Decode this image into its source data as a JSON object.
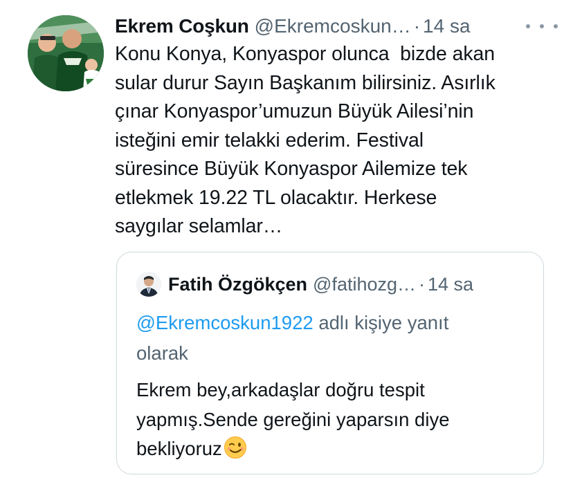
{
  "tweet": {
    "author_name": "Ekrem Coşkun",
    "author_handle": "@Ekremcoskun…",
    "separator": "·",
    "time": "14 sa",
    "text": "Konu Konya, Konyaspor olunca  bizde akan sular durur Sayın Başkanım bilirsiniz. Asırlık çınar Konyaspor’umuzun Büyük Ailesi’nin isteğini emir telakki ederim. Festival süresince Büyük Konyaspor Ailemize tek etlekmek 19.22 TL olacaktır. Herkese saygılar selamlar…",
    "text_lines": [
      "Konu Konya, Konyaspor olunca  bizde akan",
      "sular durur Sayın Başkanım bilirsiniz. Asırlık",
      "çınar Konyaspor’umuzun Büyük Ailesi’nin",
      "isteğini emir telakki ederim. Festival",
      "süresince Büyük Konyaspor Ailemize tek",
      "etlekmek 19.22 TL olacaktır. Herkese",
      "saygılar selamlar…"
    ],
    "more_icon": "more-horizontal-icon"
  },
  "quote": {
    "author_name": "Fatih Özgökçen",
    "author_handle": "@fatihozg…",
    "separator": "·",
    "time": "14 sa",
    "reply_mention": "@Ekremcoskun1922",
    "reply_suffix": " adlı kişiye yanıt",
    "reply_line2": "olarak",
    "text_lines": [
      "Ekrem bey,arkadaşlar doğru tespit",
      "yapmış.Sende gereğini yaparsın diye",
      "bekliyoruz"
    ],
    "emoji": "winking-face-icon"
  },
  "colors": {
    "text": "#0f1419",
    "secondary": "#536471",
    "link": "#1d9bf0",
    "border": "#cfd9de"
  }
}
